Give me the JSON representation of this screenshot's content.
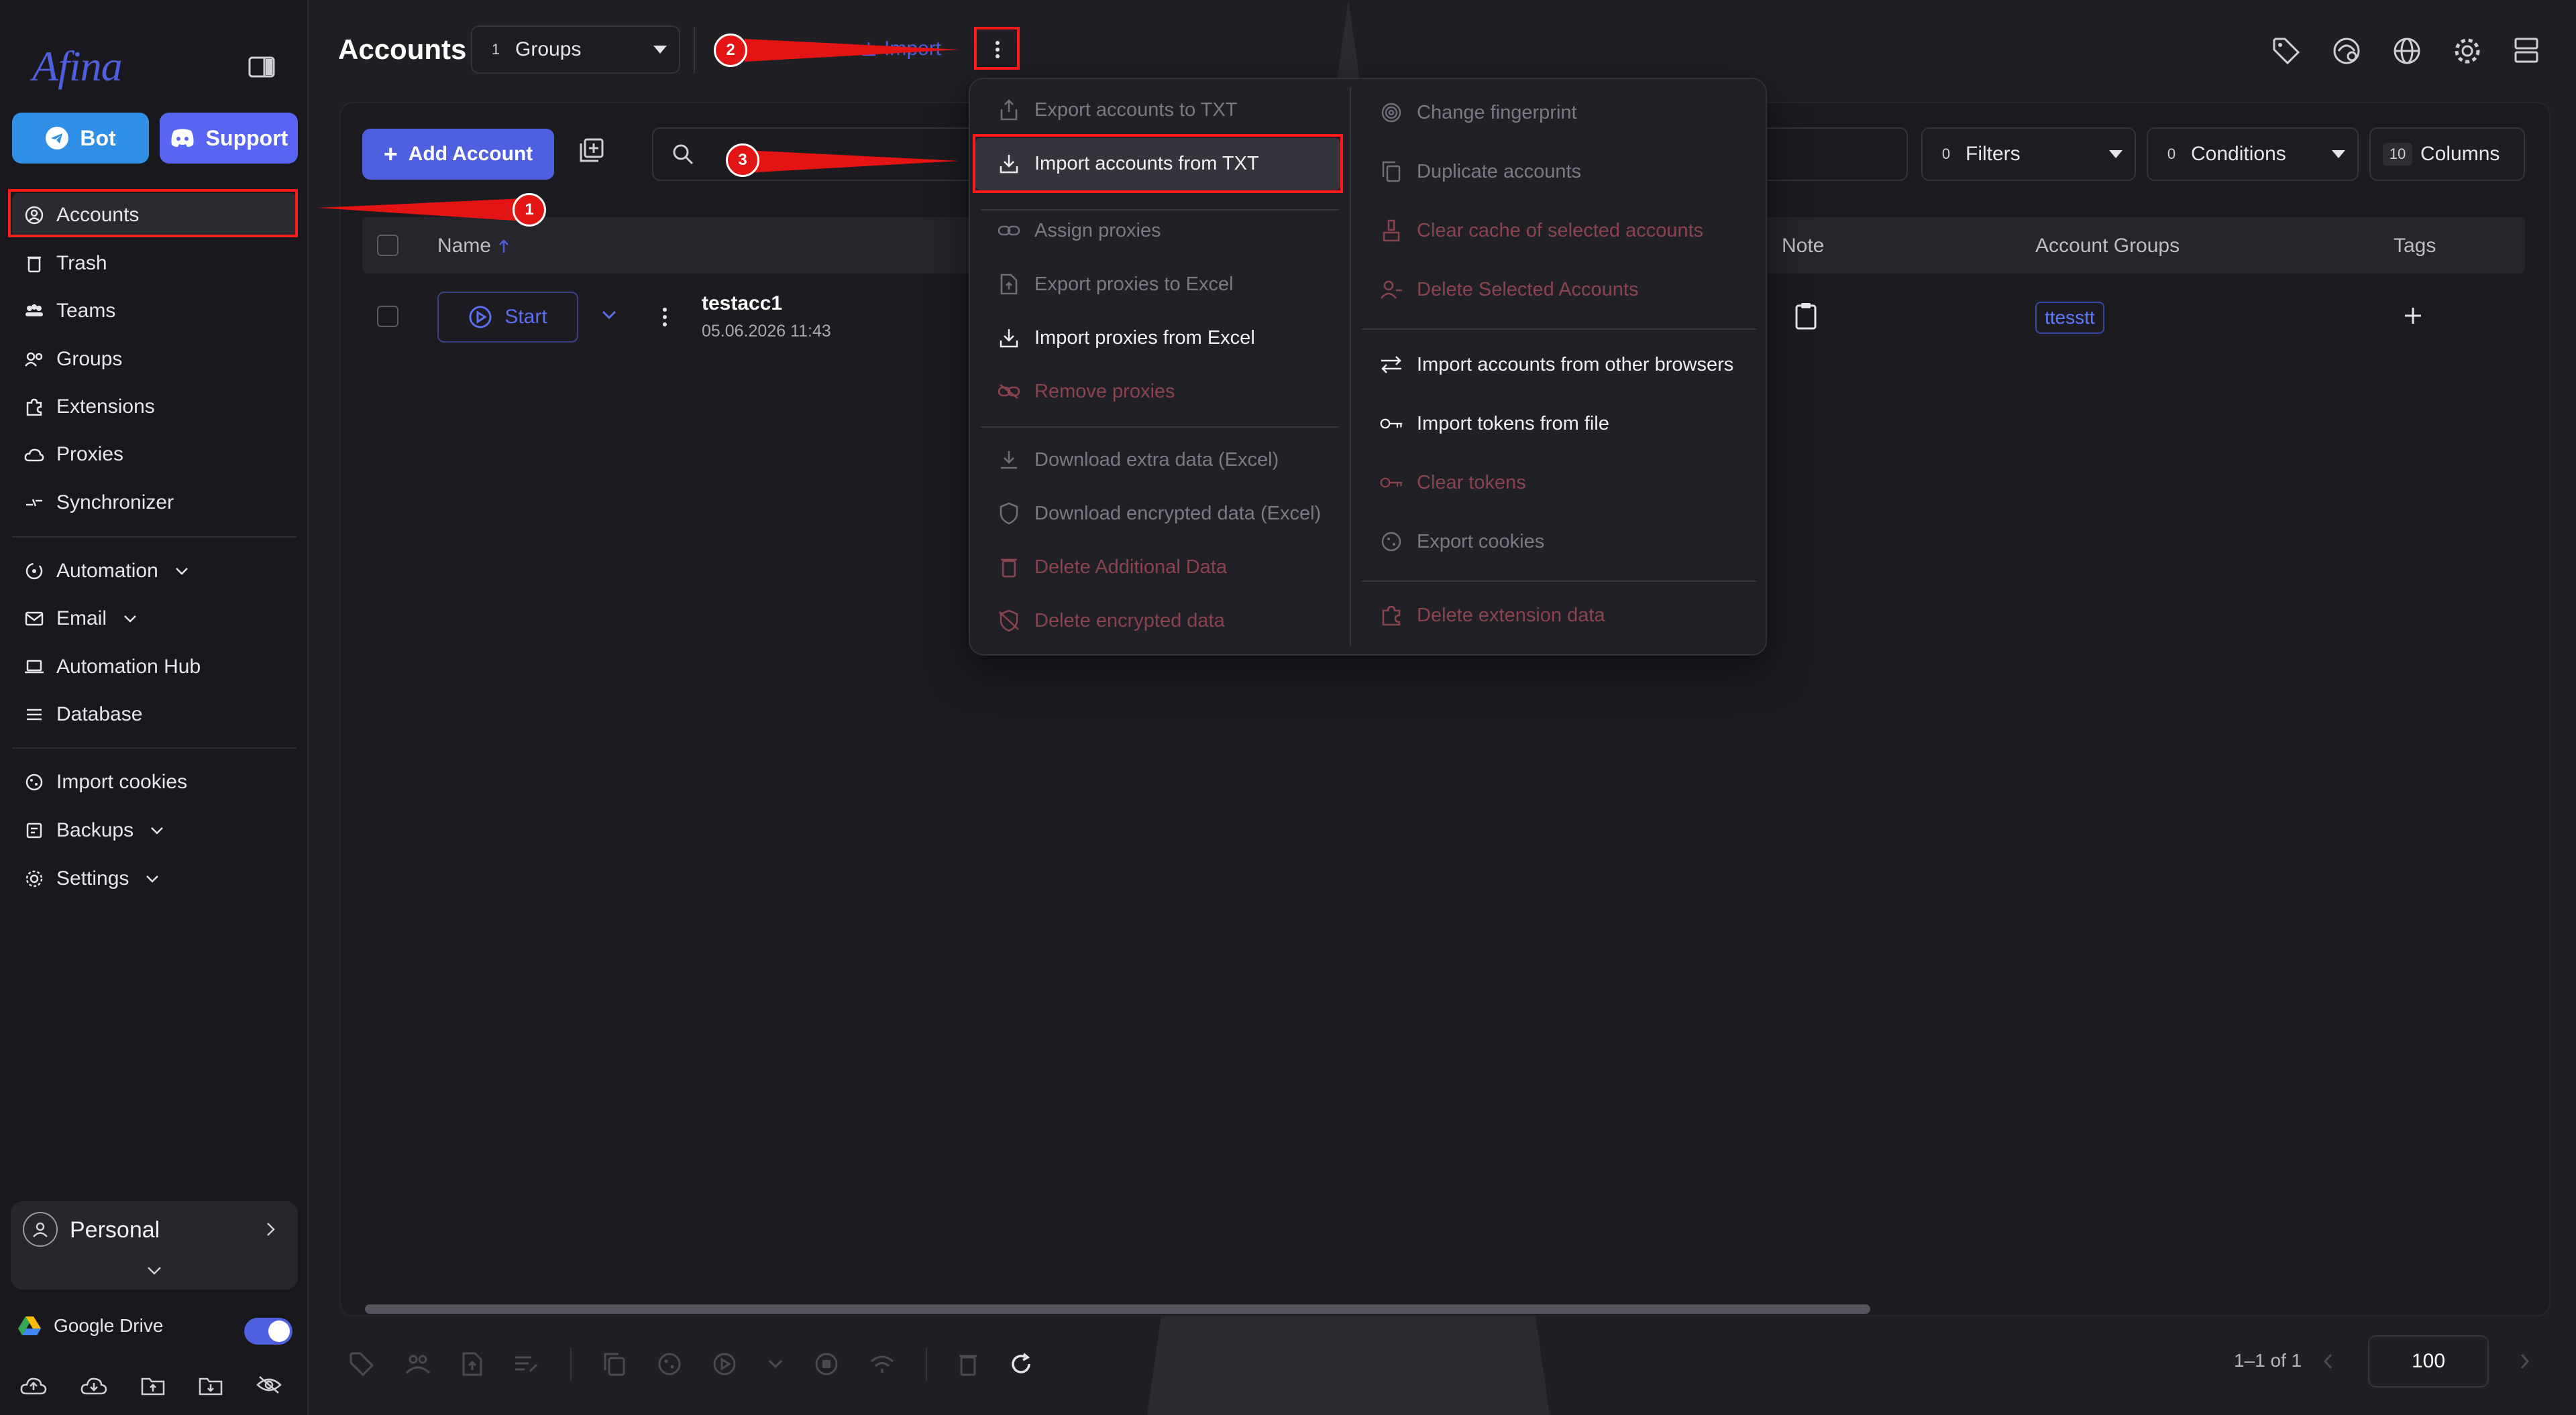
{
  "window": {
    "traffic_lights": [
      "#ff5f57",
      "#febc2e",
      "#28c840"
    ]
  },
  "sidebar": {
    "logo": "Afina",
    "bot_label": "Bot",
    "support_label": "Support",
    "items": [
      {
        "label": "Accounts"
      },
      {
        "label": "Trash"
      },
      {
        "label": "Teams"
      },
      {
        "label": "Groups"
      },
      {
        "label": "Extensions"
      },
      {
        "label": "Proxies"
      },
      {
        "label": "Synchronizer"
      },
      {
        "label": "Automation"
      },
      {
        "label": "Email"
      },
      {
        "label": "Automation Hub"
      },
      {
        "label": "Database"
      },
      {
        "label": "Import cookies"
      },
      {
        "label": "Backups"
      },
      {
        "label": "Settings"
      }
    ],
    "profile_label": "Personal",
    "gdrive_label": "Google Drive",
    "gdrive_enabled": true
  },
  "header": {
    "title": "Accounts",
    "groups_count": "1",
    "groups_label": "Groups",
    "import_label": "Import"
  },
  "toolbar": {
    "add_account_label": "Add Account",
    "filters_count": "0",
    "filters_label": "Filters",
    "conditions_count": "0",
    "conditions_label": "Conditions",
    "columns_count": "10",
    "columns_label": "Columns"
  },
  "table": {
    "headers": {
      "name": "Name",
      "note": "Note",
      "account_groups": "Account Groups",
      "tags": "Tags"
    },
    "rows": [
      {
        "start_label": "Start",
        "name": "testacc1",
        "date": "05.06.2026 11:43",
        "group": "ttesstt"
      }
    ]
  },
  "menu": {
    "left": [
      {
        "label": "Export accounts to TXT",
        "state": "dim",
        "icon": "export-icon"
      },
      {
        "label": "Import accounts from TXT",
        "state": "on",
        "icon": "import-icon"
      },
      {
        "label": "Assign proxies",
        "state": "dim",
        "icon": "link-icon"
      },
      {
        "label": "Export proxies to Excel",
        "state": "dim",
        "icon": "file-export-icon"
      },
      {
        "label": "Import proxies from Excel",
        "state": "on",
        "icon": "import-icon"
      },
      {
        "label": "Remove proxies",
        "state": "red",
        "icon": "unlink-icon"
      },
      {
        "label": "Download extra data (Excel)",
        "state": "dim",
        "icon": "download-icon"
      },
      {
        "label": "Download encrypted data (Excel)",
        "state": "dim",
        "icon": "shield-icon"
      },
      {
        "label": "Delete Additional Data",
        "state": "red",
        "icon": "trash-icon"
      },
      {
        "label": "Delete encrypted data",
        "state": "red",
        "icon": "shield-off-icon"
      }
    ],
    "right": [
      {
        "label": "Change fingerprint",
        "state": "dim",
        "icon": "fingerprint-icon"
      },
      {
        "label": "Duplicate accounts",
        "state": "dim",
        "icon": "copy-icon"
      },
      {
        "label": "Clear cache of selected accounts",
        "state": "red",
        "icon": "broom-icon"
      },
      {
        "label": "Delete Selected Accounts",
        "state": "red",
        "icon": "user-remove-icon"
      },
      {
        "label": "Import accounts from other browsers",
        "state": "on",
        "icon": "swap-icon"
      },
      {
        "label": "Import tokens from file",
        "state": "on",
        "icon": "key-icon"
      },
      {
        "label": "Clear tokens",
        "state": "red",
        "icon": "key-icon"
      },
      {
        "label": "Export cookies",
        "state": "dim",
        "icon": "cookie-icon"
      },
      {
        "label": "Delete extension data",
        "state": "red",
        "icon": "puzzle-icon"
      }
    ]
  },
  "pager": {
    "range_text": "1–1 of 1",
    "page_size": "100"
  },
  "annotations": [
    "1",
    "2",
    "3"
  ],
  "colors": {
    "accent": "#4e5fe0",
    "discord": "#5865f2",
    "bot": "#2f8ee6",
    "highlight": "#ff1a1a"
  }
}
